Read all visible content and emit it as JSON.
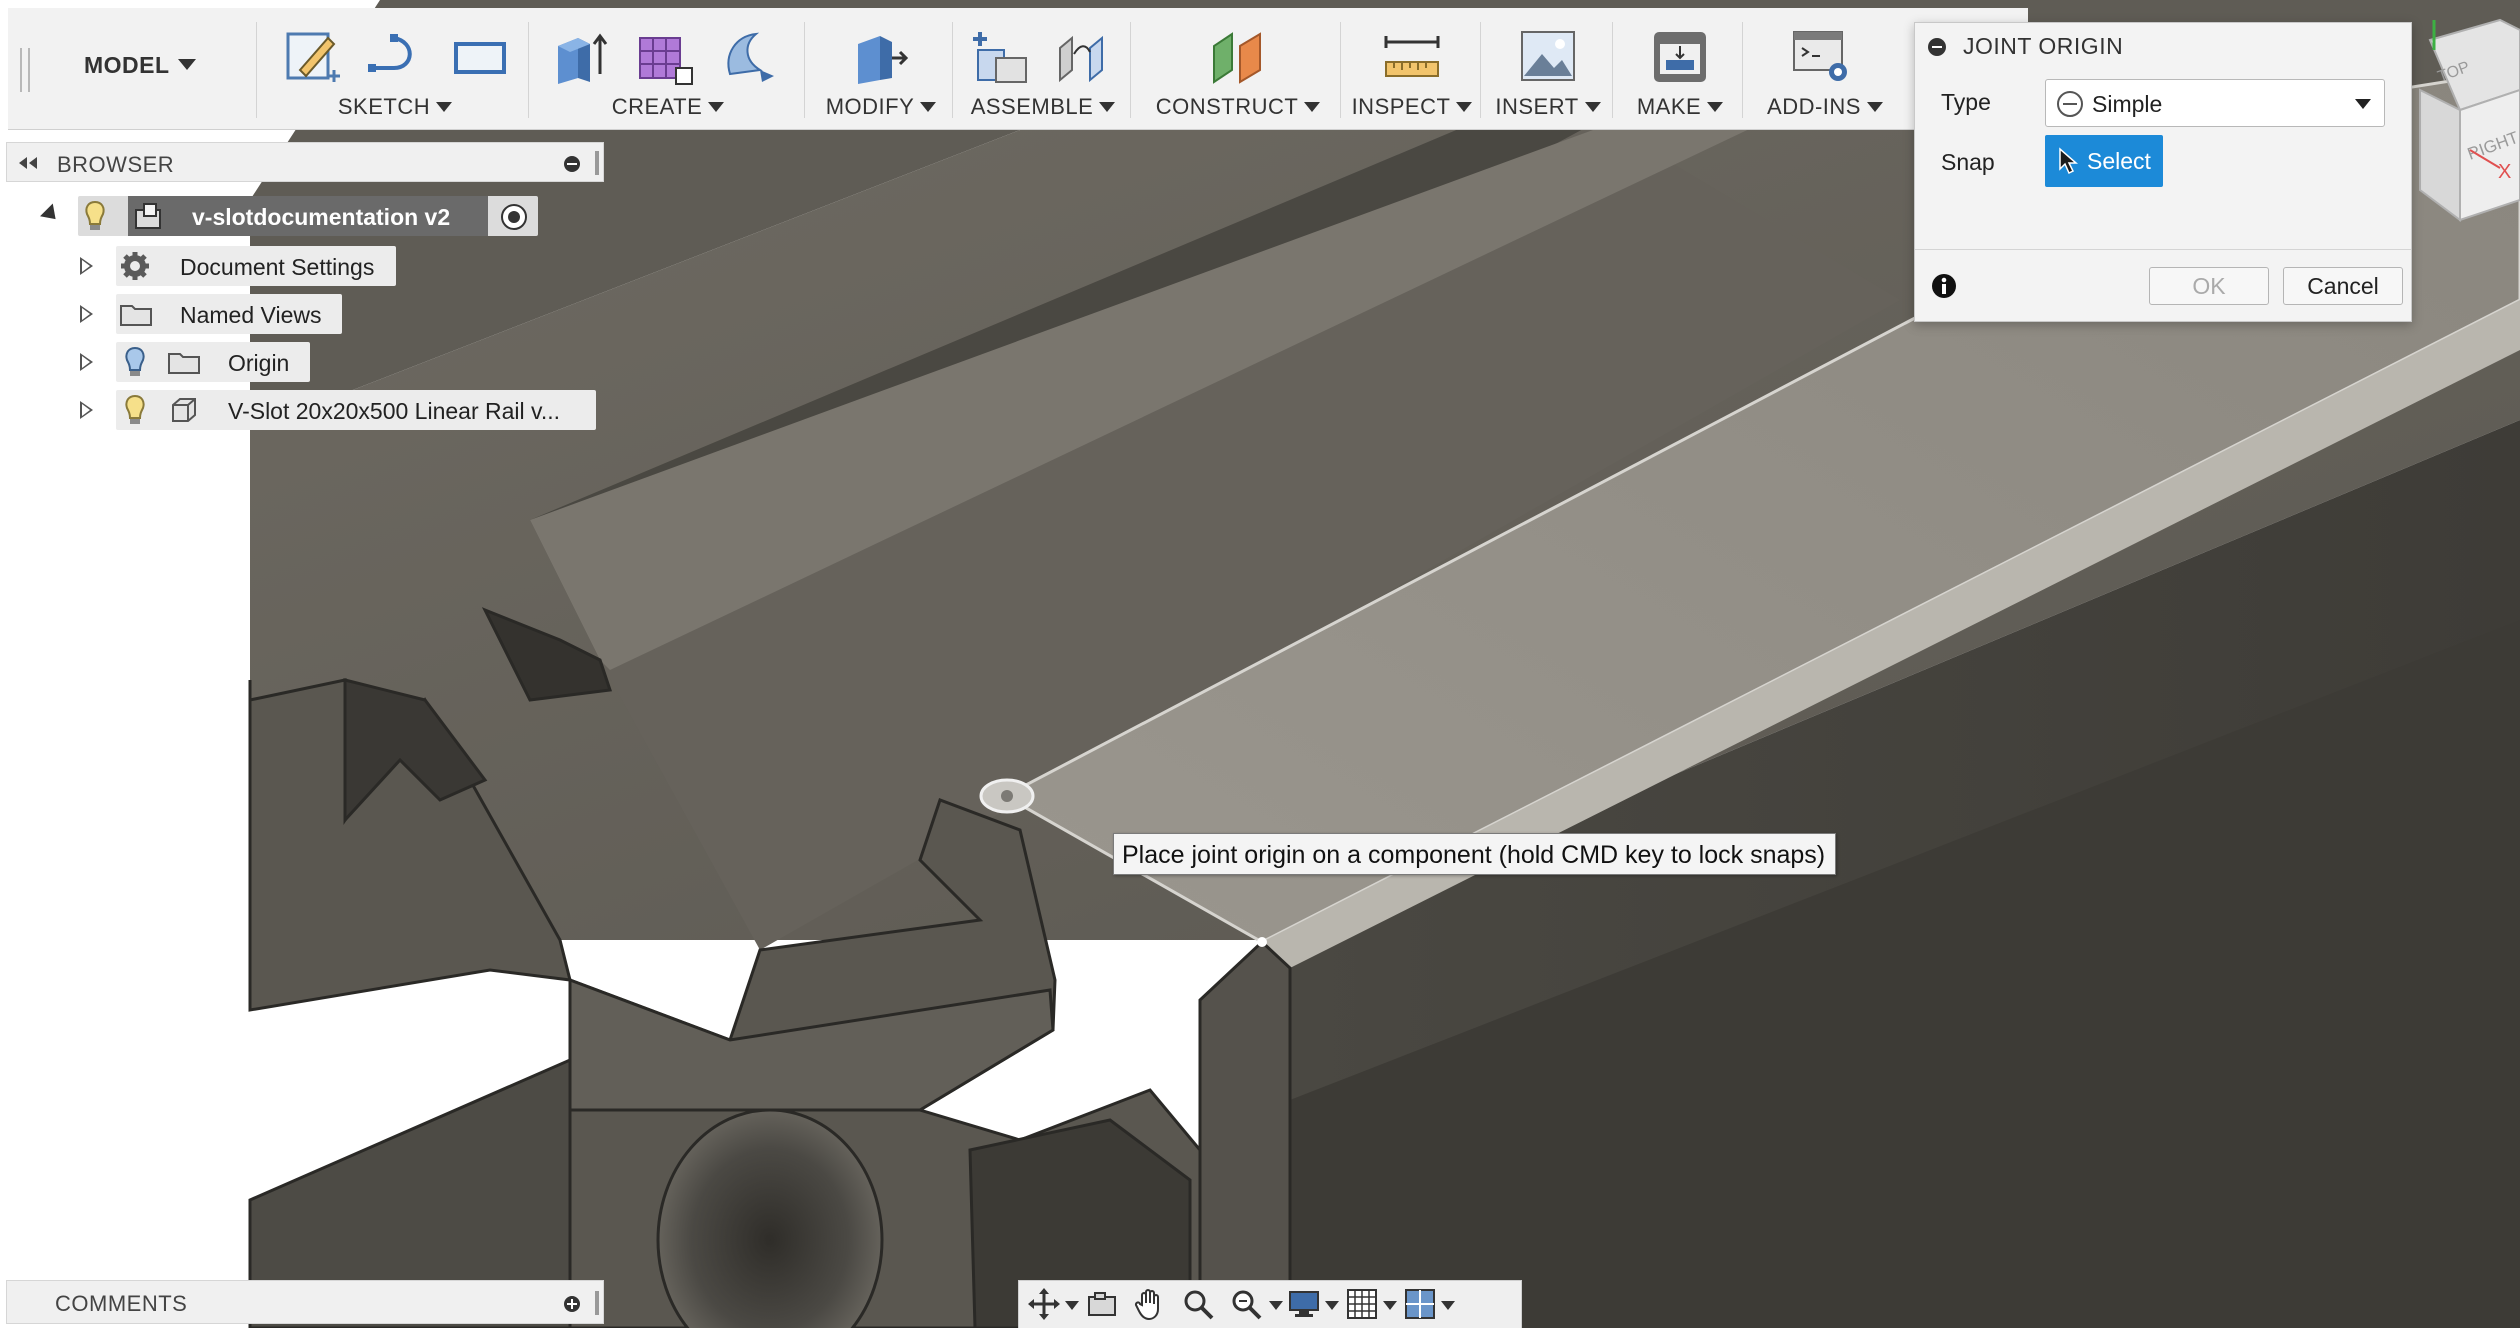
{
  "toolbar": {
    "workspace": "MODEL",
    "groups": [
      {
        "label": "SKETCH"
      },
      {
        "label": "CREATE"
      },
      {
        "label": "MODIFY"
      },
      {
        "label": "ASSEMBLE"
      },
      {
        "label": "CONSTRUCT"
      },
      {
        "label": "INSPECT"
      },
      {
        "label": "INSERT"
      },
      {
        "label": "MAKE"
      },
      {
        "label": "ADD-INS"
      }
    ]
  },
  "browser": {
    "title": "BROWSER",
    "root": {
      "label": "v-slotdocumentation v2"
    },
    "items": [
      {
        "label": "Document Settings",
        "icon": "gear-icon"
      },
      {
        "label": "Named Views",
        "icon": "folder-icon"
      },
      {
        "label": "Origin",
        "icon": "folder-icon"
      },
      {
        "label": "V-Slot 20x20x500 Linear Rail v...",
        "icon": "body-icon"
      }
    ]
  },
  "comments": {
    "title": "COMMENTS"
  },
  "dialog": {
    "title": "JOINT ORIGIN",
    "type_label": "Type",
    "type_value": "Simple",
    "snap_label": "Snap",
    "select_label": "Select",
    "ok_label": "OK",
    "cancel_label": "Cancel"
  },
  "viewcube": {
    "face_top": "TOP",
    "face_right": "RIGHT",
    "axis_x": "X"
  },
  "tooltip": {
    "text": "Place joint origin on a component (hold CMD key to lock snaps)"
  },
  "colors": {
    "accent": "#1c8ad8",
    "model_face": "#5d5a53",
    "highlight_face": "#8f8b83"
  }
}
